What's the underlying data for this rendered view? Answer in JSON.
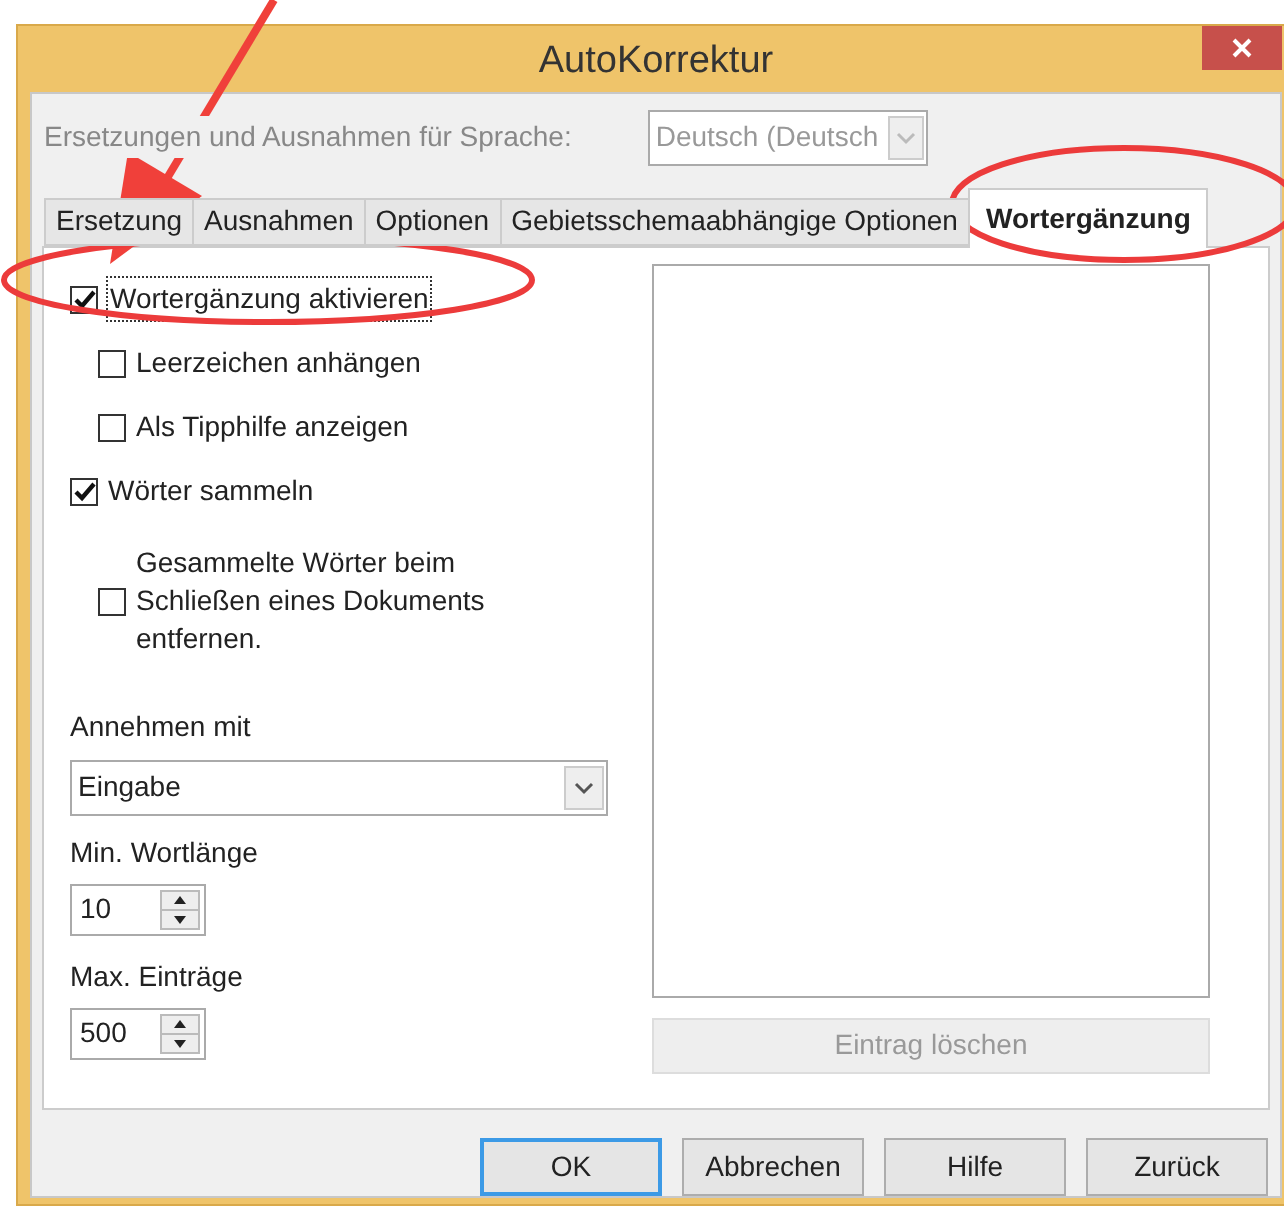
{
  "window": {
    "title": "AutoKorrektur"
  },
  "language": {
    "label": "Ersetzungen und Ausnahmen für Sprache:",
    "value": "Deutsch (Deutsch",
    "disabled": true
  },
  "tabs": [
    {
      "label": "Ersetzung",
      "selected": false
    },
    {
      "label": "Ausnahmen",
      "selected": false
    },
    {
      "label": "Optionen",
      "selected": false
    },
    {
      "label": "Gebietsschemaabhängige Optionen",
      "selected": false
    },
    {
      "label": "Wortergänzung",
      "selected": true
    }
  ],
  "options": [
    {
      "label": "Wortergänzung aktivieren",
      "checked": true,
      "focused": true,
      "children": [
        {
          "label": "Leerzeichen anhängen",
          "checked": false,
          "focused": false
        },
        {
          "label": "Als Tipphilfe anzeigen",
          "checked": false,
          "focused": false
        }
      ]
    },
    {
      "label": "Wörter sammeln",
      "checked": true,
      "focused": false,
      "children": [
        {
          "label": "Gesammelte Wörter beim Schließen eines Dokuments entfernen.",
          "checked": false,
          "focused": false
        }
      ]
    }
  ],
  "accept": {
    "label": "Annehmen mit",
    "value": "Eingabe"
  },
  "min_length": {
    "label": "Min. Wortlänge",
    "value": "10"
  },
  "max_entries": {
    "label": "Max. Einträge",
    "value": "500"
  },
  "delete_button": {
    "label": "Eintrag löschen",
    "disabled": true
  },
  "buttons": [
    {
      "label": "OK",
      "default": true
    },
    {
      "label": "Abbrechen",
      "default": false
    },
    {
      "label": "Hilfe",
      "default": false
    },
    {
      "label": "Zurück",
      "default": false
    }
  ]
}
